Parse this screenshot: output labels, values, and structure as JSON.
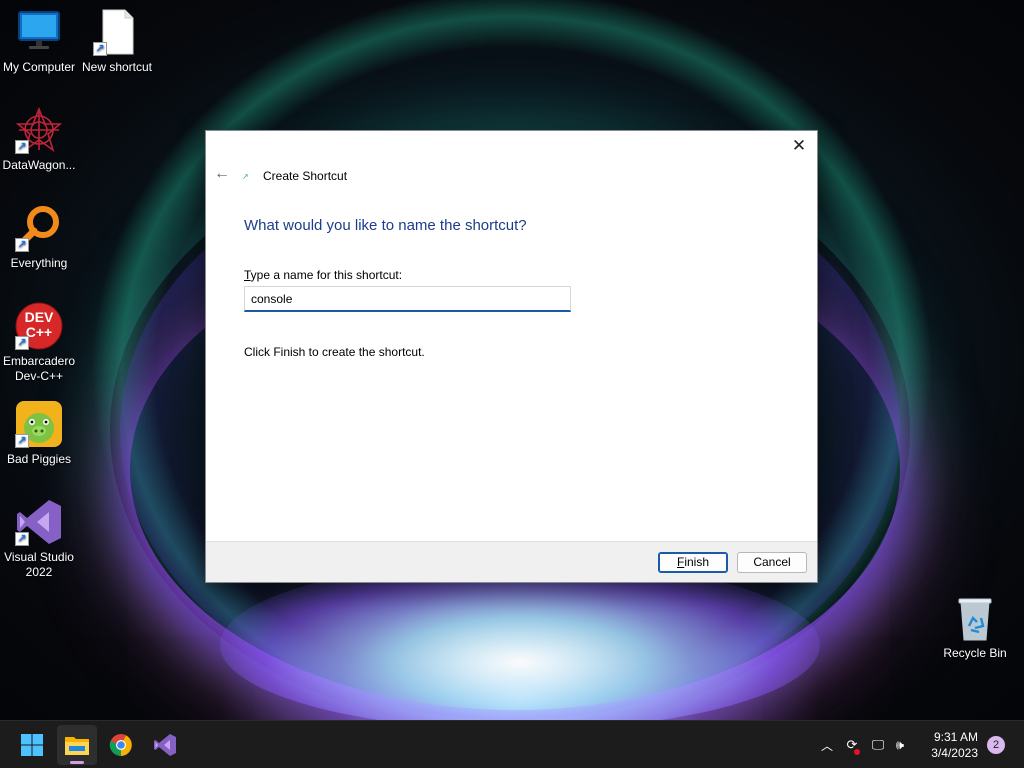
{
  "desktop": {
    "icons": [
      {
        "label": "My Computer",
        "icon": "monitor-icon"
      },
      {
        "label": "New shortcut",
        "icon": "blank-file-icon"
      },
      {
        "label": "DataWagon...",
        "icon": "datawagon-icon"
      },
      {
        "label": "Everything",
        "icon": "magnifier-icon"
      },
      {
        "label": "Embarcadero Dev-C++",
        "icon": "devcpp-icon",
        "logo_text": "DEV C++"
      },
      {
        "label": "Bad Piggies",
        "icon": "bad-piggies-icon"
      },
      {
        "label": "Visual Studio 2022",
        "icon": "visual-studio-icon"
      }
    ],
    "recycle_bin": {
      "label": "Recycle Bin",
      "icon": "recycle-bin-icon"
    }
  },
  "dialog": {
    "title": "Create Shortcut",
    "heading": "What would you like to name the shortcut?",
    "field_label_prefix": "T",
    "field_label_rest": "ype a name for this shortcut:",
    "name_value": "console",
    "hint": "Click Finish to create the shortcut.",
    "finish_prefix": "F",
    "finish_rest": "inish",
    "cancel_label": "Cancel",
    "close_glyph": "✕",
    "back_glyph": "←"
  },
  "taskbar": {
    "apps": [
      {
        "name": "Start",
        "icon": "windows-start-icon"
      },
      {
        "name": "File Explorer",
        "icon": "file-explorer-icon",
        "active": true
      },
      {
        "name": "Google Chrome",
        "icon": "chrome-icon"
      },
      {
        "name": "Visual Studio",
        "icon": "visual-studio-icon"
      }
    ],
    "clock_time": "9:31 AM",
    "clock_date": "3/4/2023",
    "notification_count": "2"
  },
  "colors": {
    "accent": "#1b5aa6",
    "heading": "#1c3d8a",
    "taskbar": "#1c1c1c"
  }
}
